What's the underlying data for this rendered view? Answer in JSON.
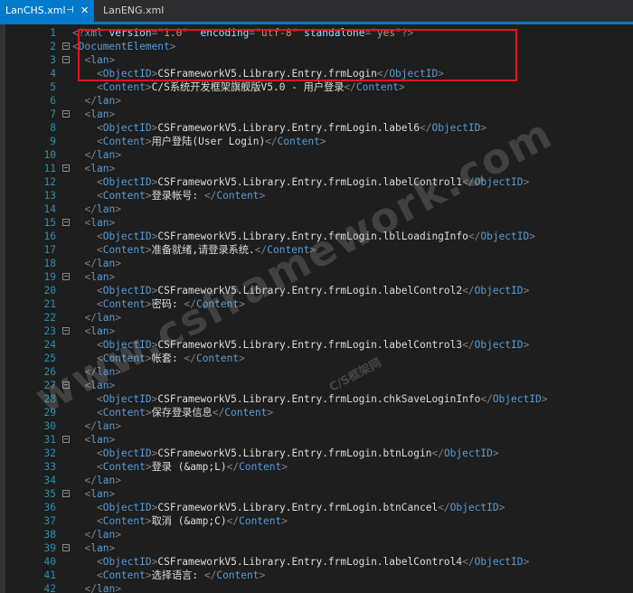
{
  "tabs": [
    {
      "label": "LanCHS.xml",
      "active": true,
      "pin_icon": "pin-icon",
      "close_icon": "close-icon"
    },
    {
      "label": "LanENG.xml",
      "active": false
    }
  ],
  "colors": {
    "accent": "#007acc",
    "background": "#1e1e1e",
    "line_number": "#2b91af",
    "tag": "#569cd6",
    "attribute": "#9cdcfe",
    "attribute_value": "#ce9178",
    "bracket": "#808080",
    "highlight_border": "#e81123"
  },
  "watermark": {
    "main": "www.csframework.com",
    "sub": "C/S框架网"
  },
  "lines": [
    {
      "n": "1",
      "fold": "",
      "indent": "",
      "tokens": [
        {
          "c": "b",
          "t": "<?"
        },
        {
          "c": "t",
          "t": "xml"
        },
        {
          "c": "x",
          "t": " "
        },
        {
          "c": "a",
          "t": "version"
        },
        {
          "c": "b",
          "t": "="
        },
        {
          "c": "v",
          "t": "\"1.0\""
        },
        {
          "c": "x",
          "t": "  "
        },
        {
          "c": "a",
          "t": "encoding"
        },
        {
          "c": "b",
          "t": "="
        },
        {
          "c": "v",
          "t": "\"utf-8\""
        },
        {
          "c": "x",
          "t": " "
        },
        {
          "c": "a",
          "t": "standalone"
        },
        {
          "c": "b",
          "t": "="
        },
        {
          "c": "v",
          "t": "\"yes\""
        },
        {
          "c": "b",
          "t": "?>"
        }
      ]
    },
    {
      "n": "2",
      "fold": "⊟",
      "indent": "",
      "tokens": [
        {
          "c": "b",
          "t": "<"
        },
        {
          "c": "t",
          "t": "DocumentElement"
        },
        {
          "c": "b",
          "t": ">"
        }
      ]
    },
    {
      "n": "3",
      "fold": "⊟",
      "indent": "  ",
      "tokens": [
        {
          "c": "b",
          "t": "<"
        },
        {
          "c": "t",
          "t": "lan"
        },
        {
          "c": "b",
          "t": ">"
        }
      ]
    },
    {
      "n": "4",
      "fold": "",
      "indent": "    ",
      "tokens": [
        {
          "c": "b",
          "t": "<"
        },
        {
          "c": "t",
          "t": "ObjectID"
        },
        {
          "c": "b",
          "t": ">"
        },
        {
          "c": "x",
          "t": "CSFrameworkV5.Library.Entry.frmLogin"
        },
        {
          "c": "b",
          "t": "</"
        },
        {
          "c": "t",
          "t": "ObjectID"
        },
        {
          "c": "b",
          "t": ">"
        }
      ]
    },
    {
      "n": "5",
      "fold": "",
      "indent": "    ",
      "tokens": [
        {
          "c": "b",
          "t": "<"
        },
        {
          "c": "t",
          "t": "Content"
        },
        {
          "c": "b",
          "t": ">"
        },
        {
          "c": "x",
          "t": "C/S系统开发框架旗舰版V5.0 - 用户登录"
        },
        {
          "c": "b",
          "t": "</"
        },
        {
          "c": "t",
          "t": "Content"
        },
        {
          "c": "b",
          "t": ">"
        }
      ]
    },
    {
      "n": "6",
      "fold": "",
      "indent": "  ",
      "tokens": [
        {
          "c": "b",
          "t": "</"
        },
        {
          "c": "t",
          "t": "lan"
        },
        {
          "c": "b",
          "t": ">"
        }
      ]
    },
    {
      "n": "7",
      "fold": "⊟",
      "indent": "  ",
      "tokens": [
        {
          "c": "b",
          "t": "<"
        },
        {
          "c": "t",
          "t": "lan"
        },
        {
          "c": "b",
          "t": ">"
        }
      ]
    },
    {
      "n": "8",
      "fold": "",
      "indent": "    ",
      "tokens": [
        {
          "c": "b",
          "t": "<"
        },
        {
          "c": "t",
          "t": "ObjectID"
        },
        {
          "c": "b",
          "t": ">"
        },
        {
          "c": "x",
          "t": "CSFrameworkV5.Library.Entry.frmLogin.label6"
        },
        {
          "c": "b",
          "t": "</"
        },
        {
          "c": "t",
          "t": "ObjectID"
        },
        {
          "c": "b",
          "t": ">"
        }
      ]
    },
    {
      "n": "9",
      "fold": "",
      "indent": "    ",
      "tokens": [
        {
          "c": "b",
          "t": "<"
        },
        {
          "c": "t",
          "t": "Content"
        },
        {
          "c": "b",
          "t": ">"
        },
        {
          "c": "x",
          "t": "用户登陆(User Login)"
        },
        {
          "c": "b",
          "t": "</"
        },
        {
          "c": "t",
          "t": "Content"
        },
        {
          "c": "b",
          "t": ">"
        }
      ]
    },
    {
      "n": "10",
      "fold": "",
      "indent": "  ",
      "tokens": [
        {
          "c": "b",
          "t": "</"
        },
        {
          "c": "t",
          "t": "lan"
        },
        {
          "c": "b",
          "t": ">"
        }
      ]
    },
    {
      "n": "11",
      "fold": "⊟",
      "indent": "  ",
      "tokens": [
        {
          "c": "b",
          "t": "<"
        },
        {
          "c": "t",
          "t": "lan"
        },
        {
          "c": "b",
          "t": ">"
        }
      ]
    },
    {
      "n": "12",
      "fold": "",
      "indent": "    ",
      "tokens": [
        {
          "c": "b",
          "t": "<"
        },
        {
          "c": "t",
          "t": "ObjectID"
        },
        {
          "c": "b",
          "t": ">"
        },
        {
          "c": "x",
          "t": "CSFrameworkV5.Library.Entry.frmLogin.labelControl1"
        },
        {
          "c": "b",
          "t": "</"
        },
        {
          "c": "t",
          "t": "ObjectID"
        },
        {
          "c": "b",
          "t": ">"
        }
      ]
    },
    {
      "n": "13",
      "fold": "",
      "indent": "    ",
      "tokens": [
        {
          "c": "b",
          "t": "<"
        },
        {
          "c": "t",
          "t": "Content"
        },
        {
          "c": "b",
          "t": ">"
        },
        {
          "c": "x",
          "t": "登录帐号: "
        },
        {
          "c": "b",
          "t": "</"
        },
        {
          "c": "t",
          "t": "Content"
        },
        {
          "c": "b",
          "t": ">"
        }
      ]
    },
    {
      "n": "14",
      "fold": "",
      "indent": "  ",
      "tokens": [
        {
          "c": "b",
          "t": "</"
        },
        {
          "c": "t",
          "t": "lan"
        },
        {
          "c": "b",
          "t": ">"
        }
      ]
    },
    {
      "n": "15",
      "fold": "⊟",
      "indent": "  ",
      "tokens": [
        {
          "c": "b",
          "t": "<"
        },
        {
          "c": "t",
          "t": "lan"
        },
        {
          "c": "b",
          "t": ">"
        }
      ]
    },
    {
      "n": "16",
      "fold": "",
      "indent": "    ",
      "tokens": [
        {
          "c": "b",
          "t": "<"
        },
        {
          "c": "t",
          "t": "ObjectID"
        },
        {
          "c": "b",
          "t": ">"
        },
        {
          "c": "x",
          "t": "CSFrameworkV5.Library.Entry.frmLogin.lblLoadingInfo"
        },
        {
          "c": "b",
          "t": "</"
        },
        {
          "c": "t",
          "t": "ObjectID"
        },
        {
          "c": "b",
          "t": ">"
        }
      ]
    },
    {
      "n": "17",
      "fold": "",
      "indent": "    ",
      "tokens": [
        {
          "c": "b",
          "t": "<"
        },
        {
          "c": "t",
          "t": "Content"
        },
        {
          "c": "b",
          "t": ">"
        },
        {
          "c": "x",
          "t": "准备就绪,请登录系统."
        },
        {
          "c": "b",
          "t": "</"
        },
        {
          "c": "t",
          "t": "Content"
        },
        {
          "c": "b",
          "t": ">"
        }
      ]
    },
    {
      "n": "18",
      "fold": "",
      "indent": "  ",
      "tokens": [
        {
          "c": "b",
          "t": "</"
        },
        {
          "c": "t",
          "t": "lan"
        },
        {
          "c": "b",
          "t": ">"
        }
      ]
    },
    {
      "n": "19",
      "fold": "⊟",
      "indent": "  ",
      "tokens": [
        {
          "c": "b",
          "t": "<"
        },
        {
          "c": "t",
          "t": "lan"
        },
        {
          "c": "b",
          "t": ">"
        }
      ]
    },
    {
      "n": "20",
      "fold": "",
      "indent": "    ",
      "tokens": [
        {
          "c": "b",
          "t": "<"
        },
        {
          "c": "t",
          "t": "ObjectID"
        },
        {
          "c": "b",
          "t": ">"
        },
        {
          "c": "x",
          "t": "CSFrameworkV5.Library.Entry.frmLogin.labelControl2"
        },
        {
          "c": "b",
          "t": "</"
        },
        {
          "c": "t",
          "t": "ObjectID"
        },
        {
          "c": "b",
          "t": ">"
        }
      ]
    },
    {
      "n": "21",
      "fold": "",
      "indent": "    ",
      "tokens": [
        {
          "c": "b",
          "t": "<"
        },
        {
          "c": "t",
          "t": "Content"
        },
        {
          "c": "b",
          "t": ">"
        },
        {
          "c": "x",
          "t": "密码: "
        },
        {
          "c": "b",
          "t": "</"
        },
        {
          "c": "t",
          "t": "Content"
        },
        {
          "c": "b",
          "t": ">"
        }
      ]
    },
    {
      "n": "22",
      "fold": "",
      "indent": "  ",
      "tokens": [
        {
          "c": "b",
          "t": "</"
        },
        {
          "c": "t",
          "t": "lan"
        },
        {
          "c": "b",
          "t": ">"
        }
      ]
    },
    {
      "n": "23",
      "fold": "⊟",
      "indent": "  ",
      "tokens": [
        {
          "c": "b",
          "t": "<"
        },
        {
          "c": "t",
          "t": "lan"
        },
        {
          "c": "b",
          "t": ">"
        }
      ]
    },
    {
      "n": "24",
      "fold": "",
      "indent": "    ",
      "tokens": [
        {
          "c": "b",
          "t": "<"
        },
        {
          "c": "t",
          "t": "ObjectID"
        },
        {
          "c": "b",
          "t": ">"
        },
        {
          "c": "x",
          "t": "CSFrameworkV5.Library.Entry.frmLogin.labelControl3"
        },
        {
          "c": "b",
          "t": "</"
        },
        {
          "c": "t",
          "t": "ObjectID"
        },
        {
          "c": "b",
          "t": ">"
        }
      ]
    },
    {
      "n": "25",
      "fold": "",
      "indent": "    ",
      "tokens": [
        {
          "c": "b",
          "t": "<"
        },
        {
          "c": "t",
          "t": "Content"
        },
        {
          "c": "b",
          "t": ">"
        },
        {
          "c": "x",
          "t": "帐套: "
        },
        {
          "c": "b",
          "t": "</"
        },
        {
          "c": "t",
          "t": "Content"
        },
        {
          "c": "b",
          "t": ">"
        }
      ]
    },
    {
      "n": "26",
      "fold": "",
      "indent": "  ",
      "tokens": [
        {
          "c": "b",
          "t": "</"
        },
        {
          "c": "t",
          "t": "lan"
        },
        {
          "c": "b",
          "t": ">"
        }
      ]
    },
    {
      "n": "27",
      "fold": "⊟",
      "indent": "  ",
      "tokens": [
        {
          "c": "b",
          "t": "<"
        },
        {
          "c": "t",
          "t": "lan"
        },
        {
          "c": "b",
          "t": ">"
        }
      ]
    },
    {
      "n": "28",
      "fold": "",
      "indent": "    ",
      "tokens": [
        {
          "c": "b",
          "t": "<"
        },
        {
          "c": "t",
          "t": "ObjectID"
        },
        {
          "c": "b",
          "t": ">"
        },
        {
          "c": "x",
          "t": "CSFrameworkV5.Library.Entry.frmLogin.chkSaveLoginInfo"
        },
        {
          "c": "b",
          "t": "</"
        },
        {
          "c": "t",
          "t": "ObjectID"
        },
        {
          "c": "b",
          "t": ">"
        }
      ]
    },
    {
      "n": "29",
      "fold": "",
      "indent": "    ",
      "tokens": [
        {
          "c": "b",
          "t": "<"
        },
        {
          "c": "t",
          "t": "Content"
        },
        {
          "c": "b",
          "t": ">"
        },
        {
          "c": "x",
          "t": "保存登录信息"
        },
        {
          "c": "b",
          "t": "</"
        },
        {
          "c": "t",
          "t": "Content"
        },
        {
          "c": "b",
          "t": ">"
        }
      ]
    },
    {
      "n": "30",
      "fold": "",
      "indent": "  ",
      "tokens": [
        {
          "c": "b",
          "t": "</"
        },
        {
          "c": "t",
          "t": "lan"
        },
        {
          "c": "b",
          "t": ">"
        }
      ]
    },
    {
      "n": "31",
      "fold": "⊟",
      "indent": "  ",
      "tokens": [
        {
          "c": "b",
          "t": "<"
        },
        {
          "c": "t",
          "t": "lan"
        },
        {
          "c": "b",
          "t": ">"
        }
      ]
    },
    {
      "n": "32",
      "fold": "",
      "indent": "    ",
      "tokens": [
        {
          "c": "b",
          "t": "<"
        },
        {
          "c": "t",
          "t": "ObjectID"
        },
        {
          "c": "b",
          "t": ">"
        },
        {
          "c": "x",
          "t": "CSFrameworkV5.Library.Entry.frmLogin.btnLogin"
        },
        {
          "c": "b",
          "t": "</"
        },
        {
          "c": "t",
          "t": "ObjectID"
        },
        {
          "c": "b",
          "t": ">"
        }
      ]
    },
    {
      "n": "33",
      "fold": "",
      "indent": "    ",
      "tokens": [
        {
          "c": "b",
          "t": "<"
        },
        {
          "c": "t",
          "t": "Content"
        },
        {
          "c": "b",
          "t": ">"
        },
        {
          "c": "x",
          "t": "登录 (&amp;L)"
        },
        {
          "c": "b",
          "t": "</"
        },
        {
          "c": "t",
          "t": "Content"
        },
        {
          "c": "b",
          "t": ">"
        }
      ]
    },
    {
      "n": "34",
      "fold": "",
      "indent": "  ",
      "tokens": [
        {
          "c": "b",
          "t": "</"
        },
        {
          "c": "t",
          "t": "lan"
        },
        {
          "c": "b",
          "t": ">"
        }
      ]
    },
    {
      "n": "35",
      "fold": "⊟",
      "indent": "  ",
      "tokens": [
        {
          "c": "b",
          "t": "<"
        },
        {
          "c": "t",
          "t": "lan"
        },
        {
          "c": "b",
          "t": ">"
        }
      ]
    },
    {
      "n": "36",
      "fold": "",
      "indent": "    ",
      "tokens": [
        {
          "c": "b",
          "t": "<"
        },
        {
          "c": "t",
          "t": "ObjectID"
        },
        {
          "c": "b",
          "t": ">"
        },
        {
          "c": "x",
          "t": "CSFrameworkV5.Library.Entry.frmLogin.btnCancel"
        },
        {
          "c": "b",
          "t": "</"
        },
        {
          "c": "t",
          "t": "ObjectID"
        },
        {
          "c": "b",
          "t": ">"
        }
      ]
    },
    {
      "n": "37",
      "fold": "",
      "indent": "    ",
      "tokens": [
        {
          "c": "b",
          "t": "<"
        },
        {
          "c": "t",
          "t": "Content"
        },
        {
          "c": "b",
          "t": ">"
        },
        {
          "c": "x",
          "t": "取消 (&amp;C)"
        },
        {
          "c": "b",
          "t": "</"
        },
        {
          "c": "t",
          "t": "Content"
        },
        {
          "c": "b",
          "t": ">"
        }
      ]
    },
    {
      "n": "38",
      "fold": "",
      "indent": "  ",
      "tokens": [
        {
          "c": "b",
          "t": "</"
        },
        {
          "c": "t",
          "t": "lan"
        },
        {
          "c": "b",
          "t": ">"
        }
      ]
    },
    {
      "n": "39",
      "fold": "⊟",
      "indent": "  ",
      "tokens": [
        {
          "c": "b",
          "t": "<"
        },
        {
          "c": "t",
          "t": "lan"
        },
        {
          "c": "b",
          "t": ">"
        }
      ]
    },
    {
      "n": "40",
      "fold": "",
      "indent": "    ",
      "tokens": [
        {
          "c": "b",
          "t": "<"
        },
        {
          "c": "t",
          "t": "ObjectID"
        },
        {
          "c": "b",
          "t": ">"
        },
        {
          "c": "x",
          "t": "CSFrameworkV5.Library.Entry.frmLogin.labelControl4"
        },
        {
          "c": "b",
          "t": "</"
        },
        {
          "c": "t",
          "t": "ObjectID"
        },
        {
          "c": "b",
          "t": ">"
        }
      ]
    },
    {
      "n": "41",
      "fold": "",
      "indent": "    ",
      "tokens": [
        {
          "c": "b",
          "t": "<"
        },
        {
          "c": "t",
          "t": "Content"
        },
        {
          "c": "b",
          "t": ">"
        },
        {
          "c": "x",
          "t": "选择语言: "
        },
        {
          "c": "b",
          "t": "</"
        },
        {
          "c": "t",
          "t": "Content"
        },
        {
          "c": "b",
          "t": ">"
        }
      ]
    },
    {
      "n": "42",
      "fold": "",
      "indent": "  ",
      "tokens": [
        {
          "c": "b",
          "t": "</"
        },
        {
          "c": "t",
          "t": "lan"
        },
        {
          "c": "b",
          "t": ">"
        }
      ]
    }
  ]
}
